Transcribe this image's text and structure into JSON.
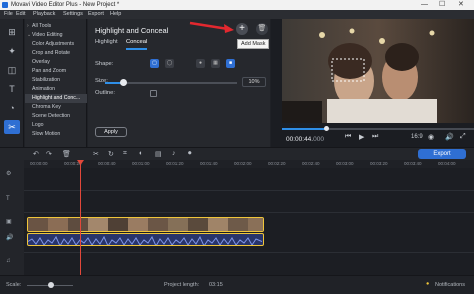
{
  "window": {
    "title": "Movavi Video Editor Plus - New Project *",
    "controls": {
      "minimize": "—",
      "maximize": "☐",
      "close": "✕"
    }
  },
  "menu": [
    "File",
    "Edit",
    "Playback",
    "Settings",
    "Export",
    "Help"
  ],
  "left_toolbar": {
    "icons": [
      "import-icon",
      "filters-icon",
      "transitions-icon",
      "titles-icon",
      "stickers-icon",
      "more-tools-icon"
    ],
    "active_index": 5
  },
  "tools_list": {
    "items": [
      {
        "label": "All Tools",
        "chev": "›"
      },
      {
        "label": "Video Editing",
        "chev": "⌄"
      },
      {
        "label": "Color Adjustments"
      },
      {
        "label": "Crop and Rotate"
      },
      {
        "label": "Overlay"
      },
      {
        "label": "Pan and Zoom"
      },
      {
        "label": "Stabilization"
      },
      {
        "label": "Animation"
      },
      {
        "label": "Highlight and Conc..."
      },
      {
        "label": "Chroma Key"
      },
      {
        "label": "Scene Detection"
      },
      {
        "label": "Logo"
      },
      {
        "label": "Slow Motion"
      }
    ],
    "selected_index": 8
  },
  "settings_panel": {
    "title": "Highlight and Conceal",
    "add_mask_tooltip": "Add Mask",
    "tabs": [
      {
        "label": "Highlight"
      },
      {
        "label": "Conceal"
      }
    ],
    "selected_tab": 1,
    "shape_label": "Shape:",
    "size_label": "Size:",
    "size_value": "10%",
    "size_fraction": 0.1,
    "outline_label": "Outline:",
    "apply_label": "Apply"
  },
  "preview": {
    "timecode_main": "00:00:44.",
    "timecode_ms": "000",
    "progress_fraction": 0.23,
    "aspect": "16:9"
  },
  "timeline": {
    "export_label": "Export",
    "ruler_ticks": [
      "00:00:00",
      "00:00:20",
      "00:00:40",
      "00:01:00",
      "00:01:20",
      "00:01:40",
      "00:02:00",
      "00:02:20",
      "00:02:40",
      "00:03:00",
      "00:03:20",
      "00:03:40",
      "00:04:00"
    ]
  },
  "status": {
    "scale_label": "Scale:",
    "project_length_label": "Project length:",
    "project_length_value": "03:15",
    "notifications_label": "Notifications"
  },
  "colors": {
    "accent": "#2f6fd3",
    "clip_border": "#f0c63a",
    "playhead": "#e2483a",
    "annotation_arrow": "#e3282f"
  }
}
